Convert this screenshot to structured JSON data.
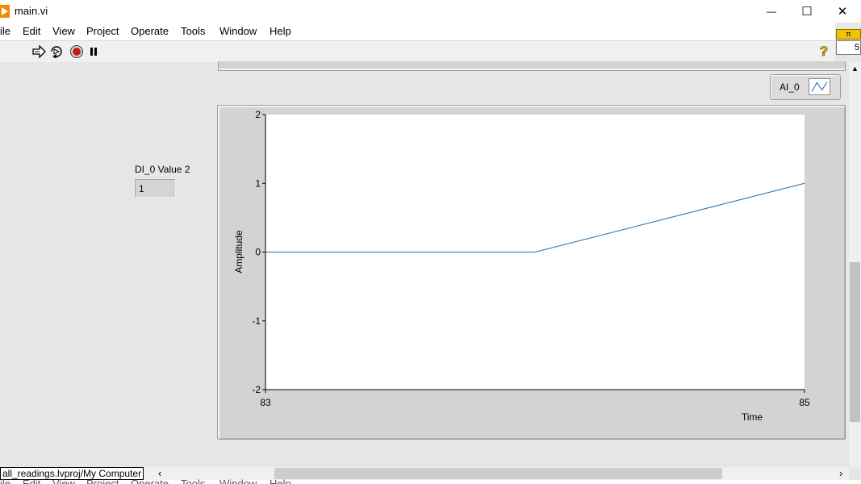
{
  "window": {
    "title": "main.vi",
    "controls": {
      "minimize": "—",
      "maximize": "☐",
      "close": "✕"
    }
  },
  "menu": [
    "ile",
    "Edit",
    "View",
    "Project",
    "Operate",
    "Tools",
    "Window",
    "Help"
  ],
  "toolbar": {
    "icons": [
      "run-arrow-icon",
      "run-continuously-icon",
      "abort-icon",
      "pause-icon",
      "context-help-icon"
    ],
    "help_glyph": "?"
  },
  "side_strip": {
    "badge": "π",
    "value": "5"
  },
  "indicator": {
    "label": "DI_0 Value 2",
    "value": "1"
  },
  "legend": {
    "label": "AI_0"
  },
  "chart_data": {
    "type": "line",
    "xlabel": "Time",
    "ylabel": "Amplitude",
    "xlim": [
      83,
      85
    ],
    "ylim": [
      -2,
      2
    ],
    "x_ticks": [
      "83",
      "85"
    ],
    "y_ticks": [
      "2",
      "1",
      "0",
      "-1",
      "-2"
    ],
    "grid": false,
    "series": [
      {
        "name": "AI_0",
        "color": "#1f6fb4",
        "x": [
          83,
          84,
          85
        ],
        "y": [
          0,
          0,
          1
        ]
      }
    ]
  },
  "statusbar": {
    "path": "all_readings.lvproj/My Computer",
    "scroll_left": "‹",
    "scroll_right": "›"
  }
}
